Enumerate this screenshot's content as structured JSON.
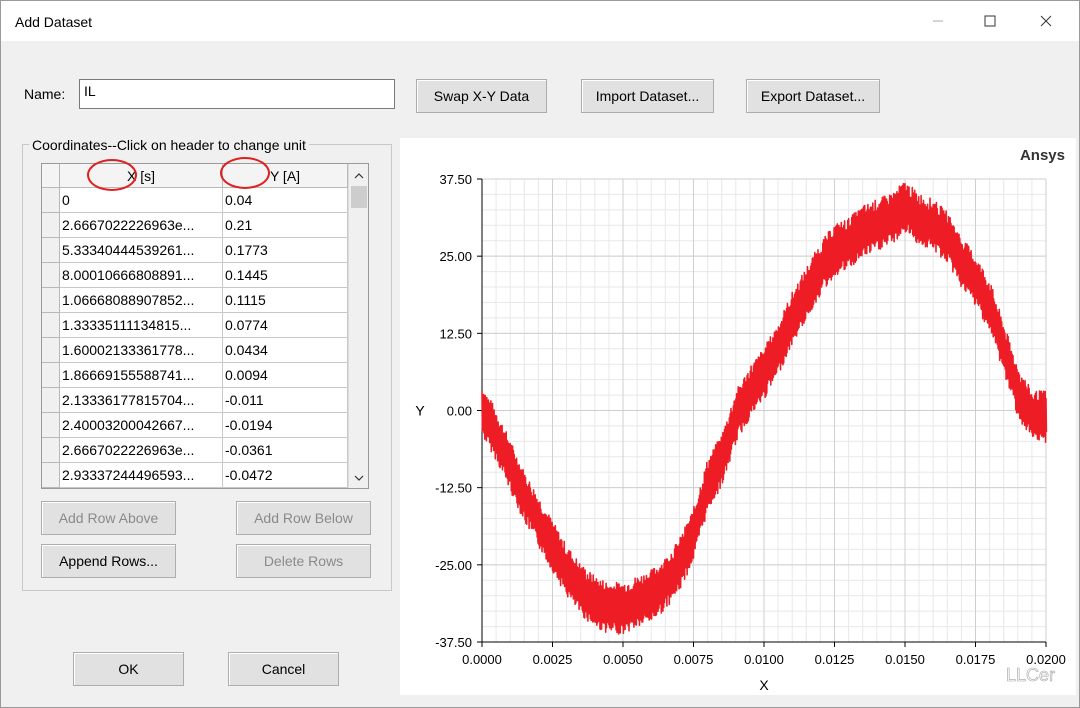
{
  "window": {
    "title": "Add Dataset"
  },
  "name_field": {
    "label": "Name:",
    "value": "IL"
  },
  "buttons": {
    "swap": "Swap X-Y Data",
    "import": "Import Dataset...",
    "export": "Export Dataset...",
    "add_above": "Add Row Above",
    "add_below": "Add Row Below",
    "append": "Append Rows...",
    "delete": "Delete Rows",
    "ok": "OK",
    "cancel": "Cancel"
  },
  "coordinates": {
    "group_label": "Coordinates--Click on header to change unit",
    "headers": [
      "X [s]",
      "Y [A]"
    ],
    "rows": [
      [
        "0",
        "0.04"
      ],
      [
        "2.6667022226963e...",
        "0.21"
      ],
      [
        "5.33340444539261...",
        "0.1773"
      ],
      [
        "8.00010666808891...",
        "0.1445"
      ],
      [
        "1.06668088907852...",
        "0.1115"
      ],
      [
        "1.33335111134815...",
        "0.0774"
      ],
      [
        "1.60002133361778...",
        "0.0434"
      ],
      [
        "1.86669155588741...",
        "0.0094"
      ],
      [
        "2.13336177815704...",
        "-0.011"
      ],
      [
        "2.40003200042667...",
        "-0.0194"
      ],
      [
        "2.6667022226963e...",
        "-0.0361"
      ],
      [
        "2.93337244496593...",
        "-0.0472"
      ]
    ]
  },
  "colors": {
    "trace": "#ee1c25",
    "annotation": "#e02020"
  },
  "chart_data": {
    "type": "line",
    "brand": "Ansys",
    "xlabel": "X",
    "ylabel": "Y",
    "xlim": [
      0,
      0.02
    ],
    "ylim": [
      -37.5,
      37.5
    ],
    "x_ticks": [
      "0.0000",
      "0.0025",
      "0.0050",
      "0.0075",
      "0.0100",
      "0.0125",
      "0.0150",
      "0.0175",
      "0.0200"
    ],
    "y_ticks": [
      "37.50",
      "25.00",
      "12.50",
      "0.00",
      "-12.50",
      "-25.00",
      "-37.50"
    ],
    "grid": true,
    "series": [
      {
        "x": [
          0,
          0.0005,
          0.001,
          0.0015,
          0.002,
          0.0025,
          0.003,
          0.0035,
          0.004,
          0.0045,
          0.005,
          0.0055,
          0.006,
          0.0065,
          0.007,
          0.0075,
          0.008,
          0.0085,
          0.009,
          0.0095,
          0.01,
          0.0105,
          0.011,
          0.0115,
          0.012,
          0.0125,
          0.013,
          0.0135,
          0.014,
          0.0145,
          0.015,
          0.0155,
          0.016,
          0.0165,
          0.017,
          0.0175,
          0.018,
          0.0185,
          0.019,
          0.0195,
          0.02
        ],
        "y": [
          0,
          -4,
          -9,
          -14,
          -18,
          -22,
          -26,
          -29,
          -31,
          -32,
          -32,
          -31,
          -30,
          -28,
          -25,
          -20,
          -12,
          -8,
          -1,
          3,
          6,
          10,
          15,
          19,
          23,
          26,
          27,
          29,
          30,
          31,
          33,
          31,
          30,
          28,
          24,
          21,
          17,
          10,
          3,
          -1,
          -1
        ],
        "band": 3.5
      }
    ],
    "watermark": "LLCer"
  }
}
